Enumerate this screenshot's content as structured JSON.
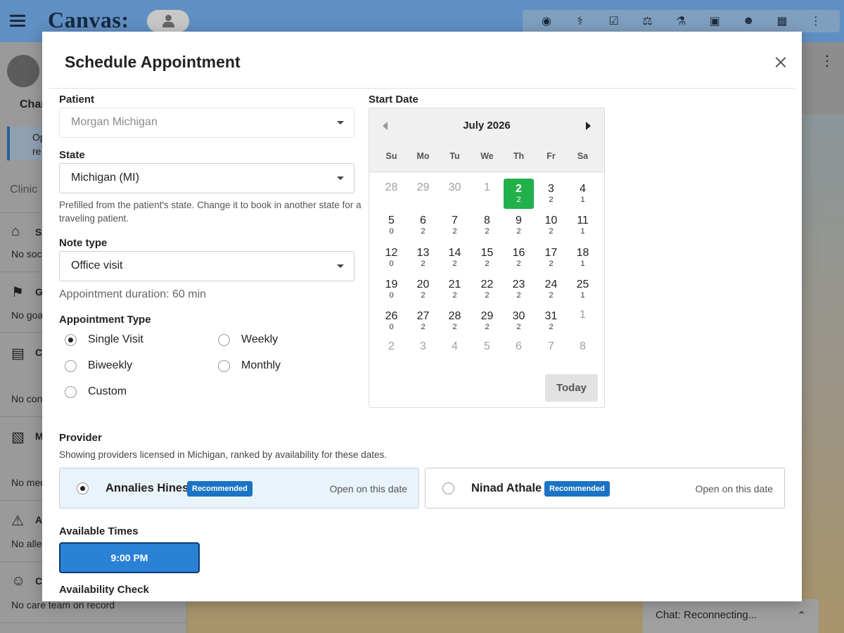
{
  "app": {
    "logo": "Canvas:",
    "toolbar_icons": [
      "globe-icon",
      "caduceus-icon",
      "checkbox-icon",
      "scales-icon",
      "flask-icon",
      "image-icon",
      "doctor-icon",
      "grid-icon",
      "kebab-icon"
    ],
    "sidebar": {
      "chart_tab": "Char",
      "info_text_1": "Op",
      "info_text_2": "re",
      "clinical_label": "Clinic",
      "sections": [
        {
          "title": "S",
          "empty": "No soci"
        },
        {
          "title": "G",
          "empty": "No goa"
        },
        {
          "title": "C",
          "empty": "No con"
        },
        {
          "title": "M",
          "empty": "No med"
        },
        {
          "title": "A",
          "empty": "No aller"
        },
        {
          "title": "C",
          "empty": "No care team on record"
        }
      ]
    },
    "chat": {
      "label": "Chat: Reconnecting..."
    }
  },
  "modal": {
    "title": "Schedule Appointment",
    "patient": {
      "label": "Patient",
      "value": "Morgan Michigan"
    },
    "state": {
      "label": "State",
      "value": "Michigan (MI)",
      "helper": "Prefilled from the patient's state. Change it to book in another state for a traveling patient."
    },
    "note_type": {
      "label": "Note type",
      "value": "Office visit"
    },
    "duration": "Appointment duration: 60 min",
    "appointment_type": {
      "label": "Appointment Type",
      "options": [
        {
          "label": "Single Visit",
          "selected": true
        },
        {
          "label": "Weekly",
          "selected": false
        },
        {
          "label": "Biweekly",
          "selected": false
        },
        {
          "label": "Monthly",
          "selected": false
        },
        {
          "label": "Custom",
          "selected": false
        }
      ]
    },
    "start_date": {
      "label": "Start Date",
      "month": "July 2026",
      "weekdays": [
        "Su",
        "Mo",
        "Tu",
        "We",
        "Th",
        "Fr",
        "Sa"
      ],
      "weeks": [
        [
          {
            "d": "28",
            "m": true
          },
          {
            "d": "29",
            "m": true
          },
          {
            "d": "30",
            "m": true
          },
          {
            "d": "1",
            "m": true
          },
          {
            "d": "2",
            "c": "2",
            "sel": true
          },
          {
            "d": "3",
            "c": "2"
          },
          {
            "d": "4",
            "c": "1"
          }
        ],
        [
          {
            "d": "5",
            "c": "0"
          },
          {
            "d": "6",
            "c": "2"
          },
          {
            "d": "7",
            "c": "2"
          },
          {
            "d": "8",
            "c": "2"
          },
          {
            "d": "9",
            "c": "2"
          },
          {
            "d": "10",
            "c": "2"
          },
          {
            "d": "11",
            "c": "1"
          }
        ],
        [
          {
            "d": "12",
            "c": "0"
          },
          {
            "d": "13",
            "c": "2"
          },
          {
            "d": "14",
            "c": "2"
          },
          {
            "d": "15",
            "c": "2"
          },
          {
            "d": "16",
            "c": "2"
          },
          {
            "d": "17",
            "c": "2"
          },
          {
            "d": "18",
            "c": "1"
          }
        ],
        [
          {
            "d": "19",
            "c": "0"
          },
          {
            "d": "20",
            "c": "2"
          },
          {
            "d": "21",
            "c": "2"
          },
          {
            "d": "22",
            "c": "2"
          },
          {
            "d": "23",
            "c": "2"
          },
          {
            "d": "24",
            "c": "2"
          },
          {
            "d": "25",
            "c": "1"
          }
        ],
        [
          {
            "d": "26",
            "c": "0"
          },
          {
            "d": "27",
            "c": "2"
          },
          {
            "d": "28",
            "c": "2"
          },
          {
            "d": "29",
            "c": "2"
          },
          {
            "d": "30",
            "c": "2"
          },
          {
            "d": "31",
            "c": "2"
          },
          {
            "d": "1",
            "m": true
          }
        ],
        [
          {
            "d": "2",
            "m": true
          },
          {
            "d": "3",
            "m": true
          },
          {
            "d": "4",
            "m": true
          },
          {
            "d": "5",
            "m": true
          },
          {
            "d": "6",
            "m": true
          },
          {
            "d": "7",
            "m": true
          },
          {
            "d": "8",
            "m": true
          }
        ]
      ],
      "today_label": "Today"
    },
    "provider": {
      "label": "Provider",
      "subtitle": "Showing providers licensed in Michigan, ranked by availability for these dates.",
      "cards": [
        {
          "name": "Annalies Hines",
          "badge": "Recommended",
          "status": "Open on this date",
          "selected": true
        },
        {
          "name": "Ninad Athale",
          "badge": "Recommended",
          "status": "Open on this date",
          "selected": false
        }
      ]
    },
    "available_times": {
      "label": "Available Times",
      "slots": [
        "9:00 PM"
      ]
    },
    "availability_check": {
      "label": "Availability Check"
    }
  },
  "colors": {
    "accent": "#2a82d6",
    "selected_day": "#21b04a",
    "badge": "#1a73c5"
  }
}
